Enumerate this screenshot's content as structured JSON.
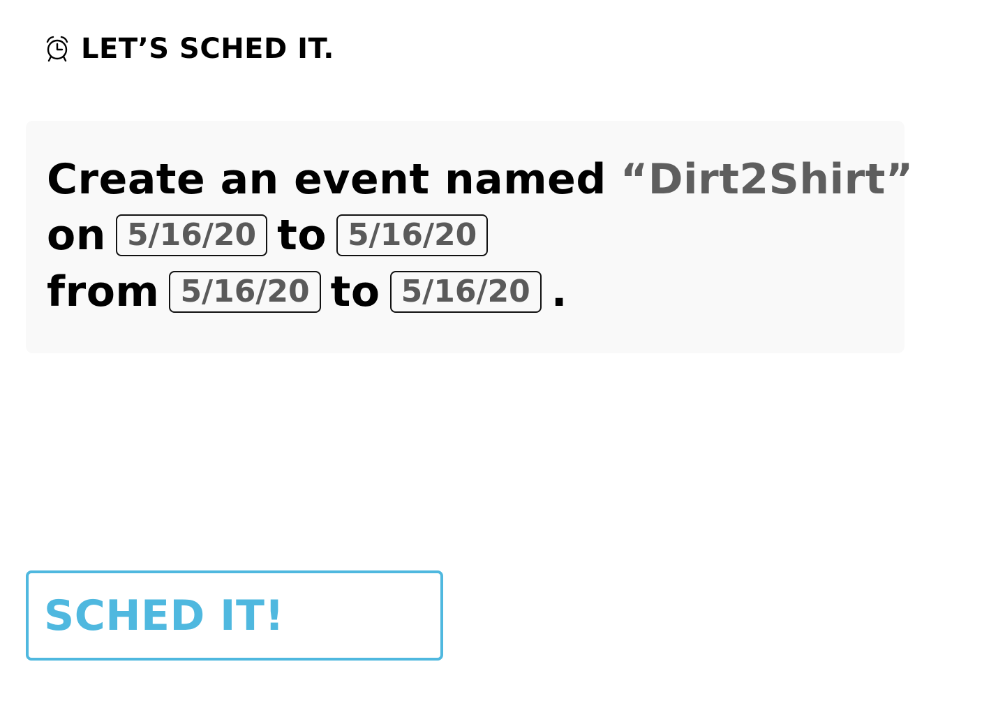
{
  "header": {
    "icon": "alarm-clock-icon",
    "title": "LET’S SCHED IT."
  },
  "sentence": {
    "line1": {
      "prefix": "Create an event named",
      "event_name": "“Dirt2Shirt”"
    },
    "line2": {
      "on_word": "on",
      "start_date": "5/16/20",
      "to_word": "to",
      "end_date": "5/16/20"
    },
    "line3": {
      "from_word": "from",
      "from_value": "5/16/20",
      "to_word": "to",
      "to_value": "5/16/20",
      "period": "."
    }
  },
  "actions": {
    "submit_label": "SCHED IT!"
  },
  "colors": {
    "accent": "#4fb8df",
    "card_background": "#f9f9f9",
    "muted_text": "#5e5e5e",
    "primary_text": "#000000"
  }
}
